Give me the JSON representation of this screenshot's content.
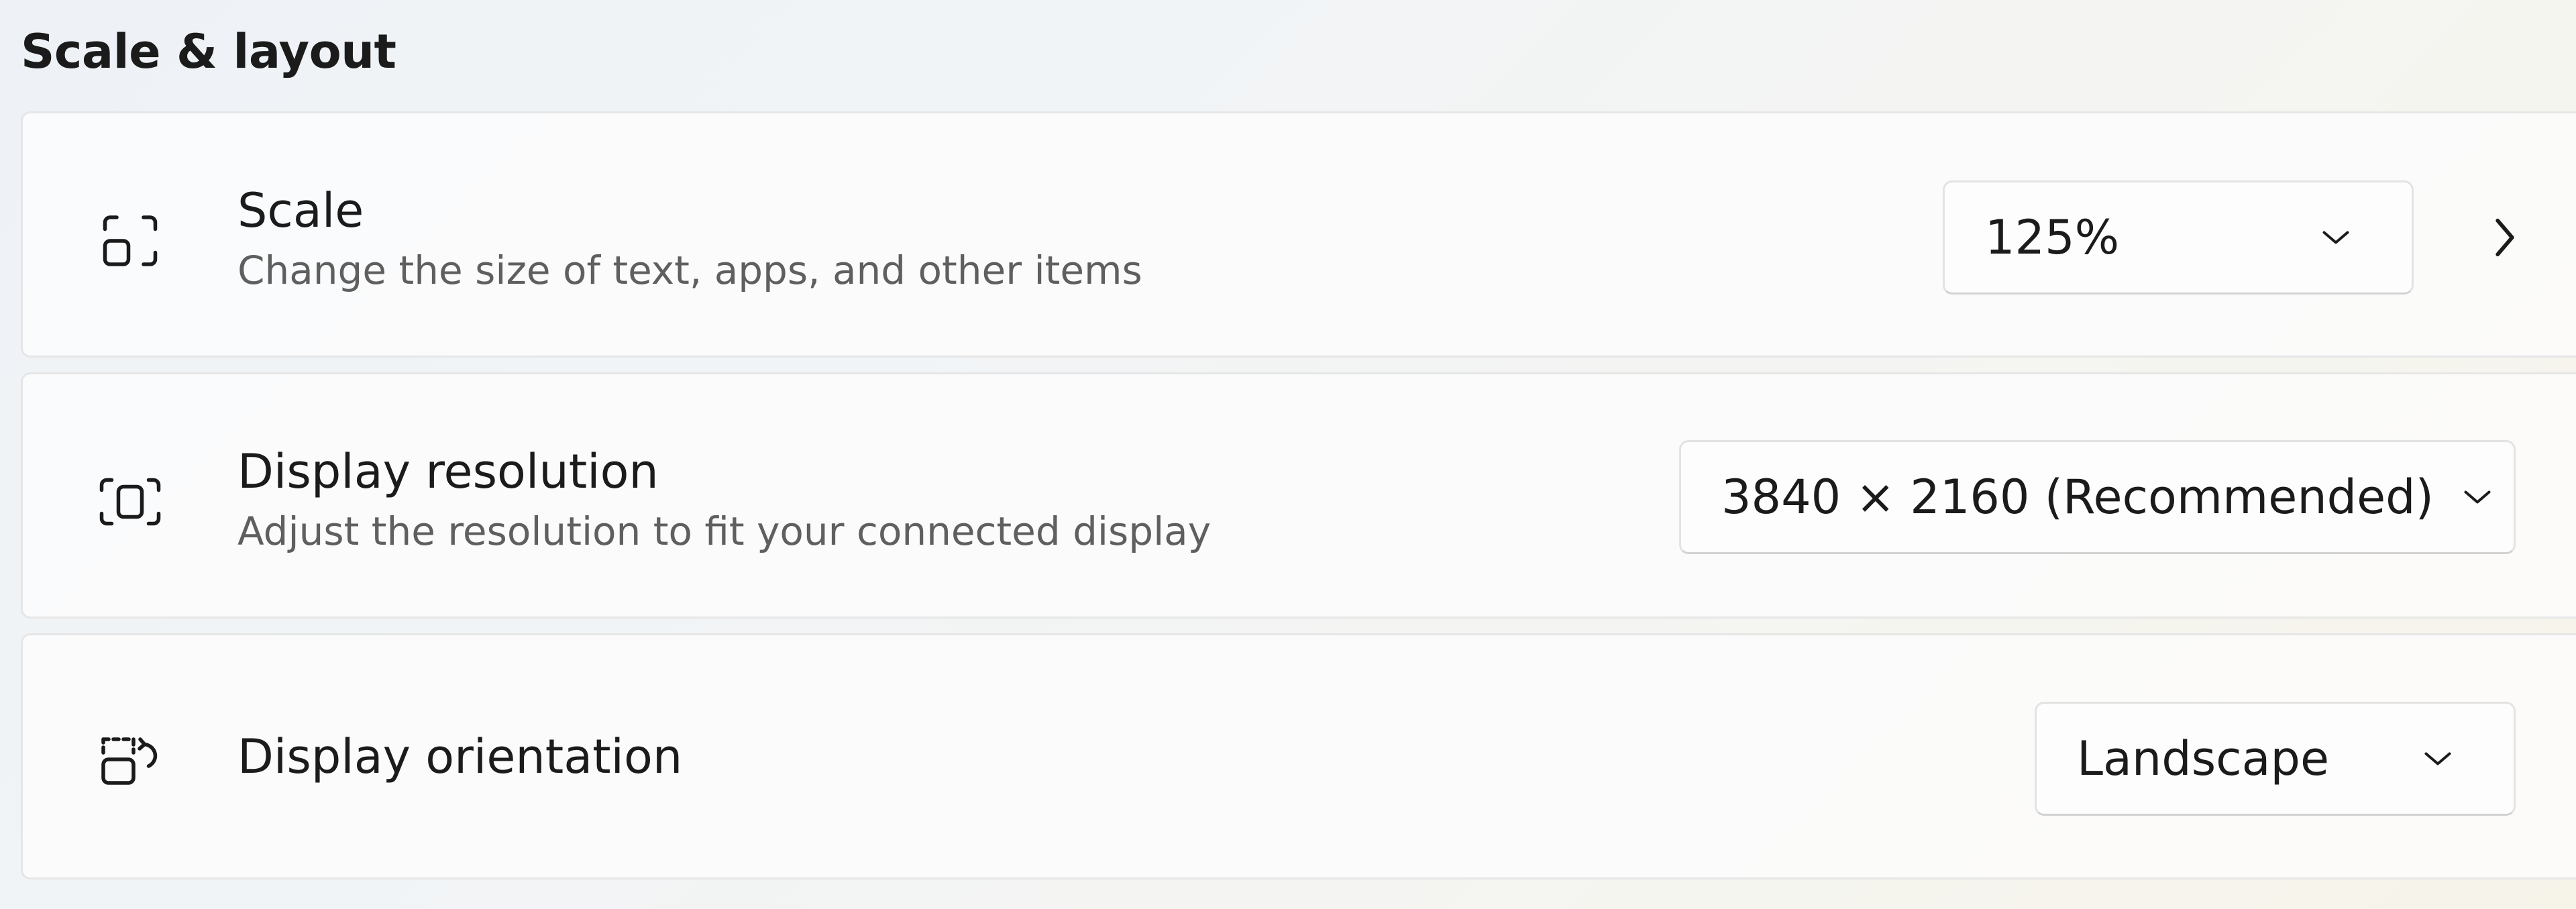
{
  "section": {
    "title": "Scale & layout"
  },
  "rows": {
    "scale": {
      "title": "Scale",
      "description": "Change the size of text, apps, and other items",
      "selected_value": "125%",
      "icon": "scale-icon",
      "has_detail_chevron": true
    },
    "resolution": {
      "title": "Display resolution",
      "description": "Adjust the resolution to fit your connected display",
      "selected_value": "3840 × 2160 (Recommended)",
      "icon": "resolution-icon"
    },
    "orientation": {
      "title": "Display orientation",
      "selected_value": "Landscape",
      "icon": "orientation-icon"
    }
  },
  "colors": {
    "text_primary": "#1b1b1b",
    "text_secondary": "#5f5f5f",
    "card_background": "#fcfcfc",
    "card_border": "#e6e6e6"
  }
}
